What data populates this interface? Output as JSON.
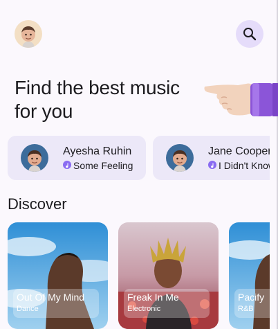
{
  "header": {
    "avatar_icon": "memoji-avatar-icon",
    "search_icon": "search-icon"
  },
  "hero": {
    "headline": "Find the best music for you",
    "illustration": "pointing-hand-icon"
  },
  "friends": [
    {
      "name": "Ayesha Ruhin",
      "status": "Some Feeling"
    },
    {
      "name": "Jane Cooper",
      "status": "I Didn't Know"
    }
  ],
  "discover": {
    "title": "Discover",
    "albums": [
      {
        "title": "Out Of My Mind",
        "genre": "Dance"
      },
      {
        "title": "Freak In Me",
        "genre": "Electronic"
      },
      {
        "title": "Pacify",
        "genre": "R&B"
      }
    ]
  },
  "colors": {
    "background": "#fbf8fd",
    "accent": "#8a6cf2",
    "card": "#ece8f8",
    "search_bg": "#e5dcfa"
  }
}
